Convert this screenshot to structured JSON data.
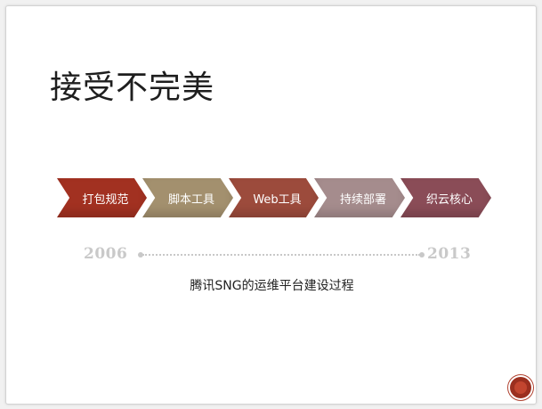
{
  "slide": {
    "title": "接受不完美",
    "steps": [
      {
        "label": "打包规范",
        "color": "#a23121"
      },
      {
        "label": "脚本工具",
        "color": "#a3906e"
      },
      {
        "label": "Web工具",
        "color": "#9c4b3c"
      },
      {
        "label": "持续部署",
        "color": "#a58c8d"
      },
      {
        "label": "织云核心",
        "color": "#8a4c57"
      }
    ],
    "timeline": {
      "start_year": "2006",
      "end_year": "2013"
    },
    "caption": "腾讯SNG的运维平台建设过程"
  }
}
